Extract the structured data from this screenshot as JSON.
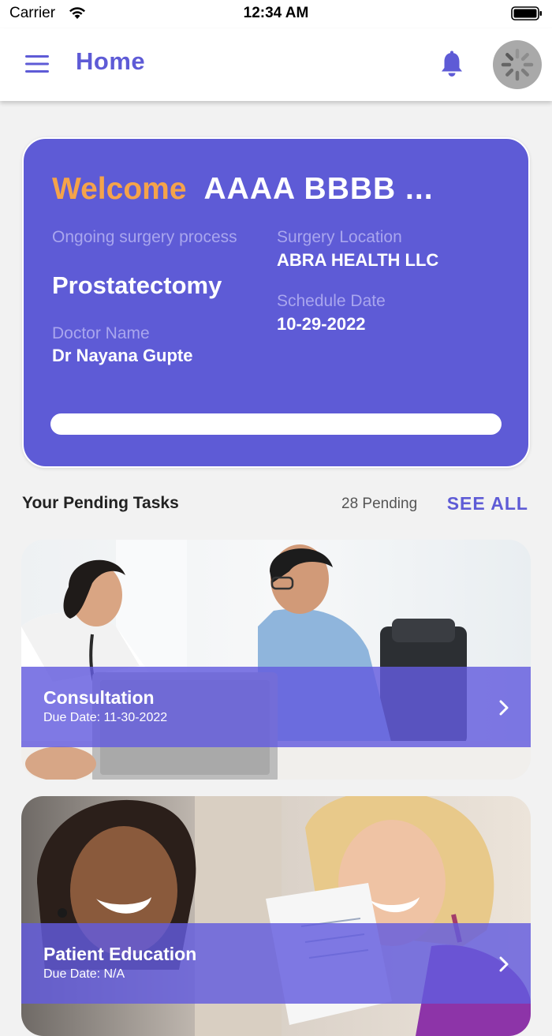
{
  "status_bar": {
    "carrier": "Carrier",
    "time": "12:34 AM"
  },
  "header": {
    "title": "Home",
    "icons": [
      "menu-icon",
      "bell-icon",
      "avatar-loading-icon"
    ]
  },
  "welcome_card": {
    "welcome_word": "Welcome",
    "user_name": "AAAA BBBB ...",
    "surgery_label": "Ongoing surgery process",
    "surgery_value": "Prostatectomy",
    "location_label": "Surgery Location",
    "location_value": "ABRA HEALTH LLC",
    "schedule_label": "Schedule Date",
    "schedule_value": "10-29-2022",
    "doctor_label": "Doctor Name",
    "doctor_value": "Dr Nayana Gupte",
    "progress": 0
  },
  "tasks": {
    "title": "Your Pending Tasks",
    "pending_count": "28 Pending",
    "see_all": "SEE ALL",
    "items": [
      {
        "title": "Consultation",
        "due": "Due Date: 11-30-2022"
      },
      {
        "title": "Patient Education",
        "due": "Due Date: N/A"
      }
    ]
  },
  "colors": {
    "accent": "#5e5bd6",
    "welcome_orange": "#f5a34a",
    "card_label": "#a9a6ee",
    "overlay": "#635bde"
  }
}
